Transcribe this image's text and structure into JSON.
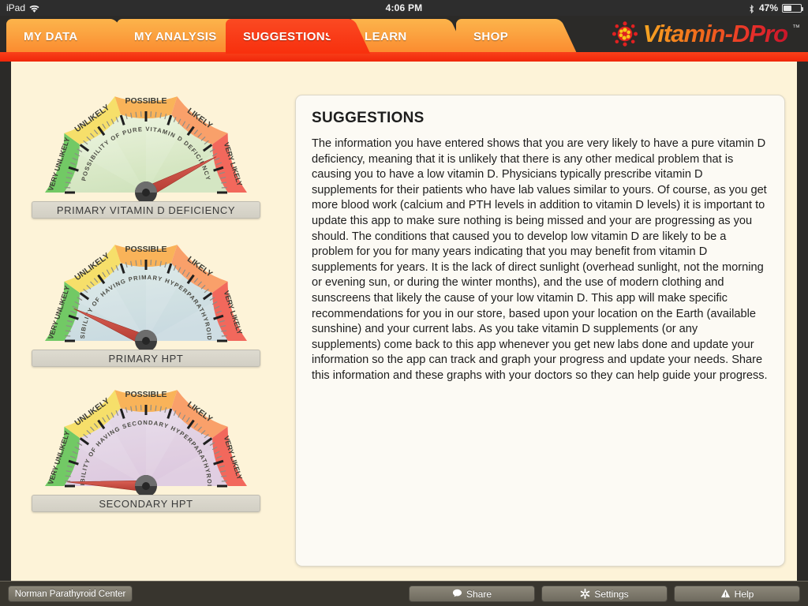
{
  "status_bar": {
    "device": "iPad",
    "wifi_icon": "wifi-icon",
    "time": "4:06 PM",
    "bluetooth_icon": "bluetooth-icon",
    "battery_percent": "47%",
    "battery_icon": "battery-icon"
  },
  "brand": {
    "logo_mark": "sun-molecule-icon",
    "name": "Vitamin-DPro",
    "trademark": "™"
  },
  "tabs": [
    {
      "label": "MY DATA",
      "active": false
    },
    {
      "label": "MY ANALYSIS",
      "active": false
    },
    {
      "label": "SUGGESTIONS",
      "active": true
    },
    {
      "label": "LEARN",
      "active": false
    },
    {
      "label": "SHOP",
      "active": false
    }
  ],
  "gauges": [
    {
      "arc_title": "POSSIBILITY OF PURE VITAMIN D DEFICIENCY",
      "caption": "PRIMARY VITAMIN D DEFICIENCY",
      "needle_value": 85,
      "needle_angle_deg": 27,
      "face_tint_from": "#eef5e0",
      "face_tint_to": "#cfe3bb",
      "zones": [
        {
          "label": "VERY UNLIKELY",
          "color": "#72c965",
          "from": 0,
          "to": 20
        },
        {
          "label": "UNLIKELY",
          "color": "#f6df6a",
          "from": 20,
          "to": 40
        },
        {
          "label": "POSSIBLE",
          "color": "#f9b359",
          "from": 40,
          "to": 60
        },
        {
          "label": "LIKELY",
          "color": "#f9a06a",
          "from": 60,
          "to": 80
        },
        {
          "label": "VERY LIKELY",
          "color": "#f2685c",
          "from": 80,
          "to": 100
        }
      ]
    },
    {
      "arc_title": "POSSIBILITY OF HAVING PRIMARY HYPERPARATHYROIDISM",
      "caption": "PRIMARY HPT",
      "needle_value": 13,
      "needle_angle_deg": 156,
      "face_tint_from": "#dbeae6",
      "face_tint_to": "#c8d9e0",
      "zones": [
        {
          "label": "VERY UNLIKELY",
          "color": "#72c965",
          "from": 0,
          "to": 20
        },
        {
          "label": "UNLIKELY",
          "color": "#f6df6a",
          "from": 20,
          "to": 40
        },
        {
          "label": "POSSIBLE",
          "color": "#f9b359",
          "from": 40,
          "to": 60
        },
        {
          "label": "LIKELY",
          "color": "#f9a06a",
          "from": 60,
          "to": 80
        },
        {
          "label": "VERY LIKELY",
          "color": "#f2685c",
          "from": 80,
          "to": 100
        }
      ]
    },
    {
      "arc_title": "POSSIBILITY OF HAVING SECONDARY HYPERPARATHYROIDISM",
      "caption": "SECONDARY HPT",
      "needle_value": 1,
      "needle_angle_deg": 177,
      "face_tint_from": "#e7dcea",
      "face_tint_to": "#dcc8de",
      "zones": [
        {
          "label": "VERY UNLIKELY",
          "color": "#72c965",
          "from": 0,
          "to": 20
        },
        {
          "label": "UNLIKELY",
          "color": "#f6df6a",
          "from": 20,
          "to": 40
        },
        {
          "label": "POSSIBLE",
          "color": "#f9b359",
          "from": 40,
          "to": 60
        },
        {
          "label": "LIKELY",
          "color": "#f9a06a",
          "from": 60,
          "to": 80
        },
        {
          "label": "VERY LIKELY",
          "color": "#f2685c",
          "from": 80,
          "to": 100
        }
      ]
    }
  ],
  "panel": {
    "title": "SUGGESTIONS",
    "body": "The information you have entered shows that you are very likely to have a pure vitamin D deficiency, meaning that it is unlikely that there is any other medical problem that is causing you to have a low vitamin D. Physicians typically prescribe vitamin D supplements for their patients who have lab values similar to yours. Of course, as you get more blood work (calcium and PTH levels in addition to vitamin D levels) it is important to update this app to make sure nothing is being missed and your are progressing as you should. The conditions that caused you to develop low vitamin D are likely to be a problem for you for many years indicating that you may benefit from vitamin D supplements for years. It is the lack of direct sunlight (overhead sunlight, not the morning or evening sun, or during the winter months), and the use of modern clothing and sunscreens that likely the cause of your low vitamin D. This app will make specific recommendations for you in our store, based upon your location on the Earth (available sunshine) and your current labs. As you take vitamin D supplements (or any supplements) come back to this app whenever you get new labs done and update your information so the app can track and graph your progress and update your needs. Share this information and these graphs with your doctors so they can help guide your progress."
  },
  "toolbar": {
    "center_label": "Norman Parathyroid Center",
    "share_label": "Share",
    "share_icon": "speech-bubble-icon",
    "settings_label": "Settings",
    "settings_icon": "gear-icon",
    "help_label": "Help",
    "help_icon": "warning-triangle-icon"
  },
  "colors": {
    "page_background": "#fdf3d8",
    "panel_background": "#fcfaf4",
    "active_tab": "#f8300d",
    "inactive_tab": "#fba441",
    "chrome_dark": "#2b2a28",
    "toolbar": "#38352e"
  }
}
